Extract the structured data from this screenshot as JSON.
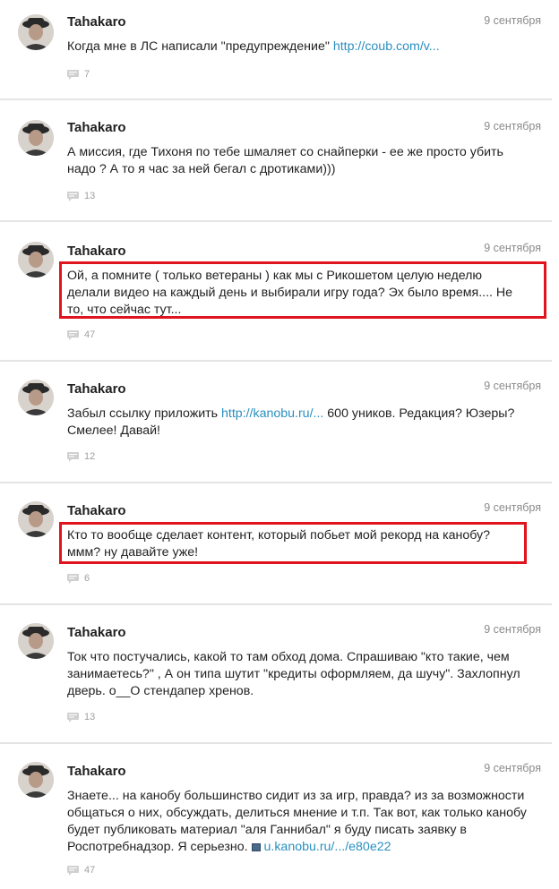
{
  "posts": [
    {
      "author": "Tahakaro",
      "date": "9 сентября",
      "text": "Когда мне в ЛС написали \"предупреждение\" ",
      "link": "http://coub.com/v...",
      "comments": "7"
    },
    {
      "author": "Tahakaro",
      "date": "9 сентября",
      "text": "А миссия, где Тихоня по тебе шмаляет со снайперки - ее же просто убить надо ? А то я час за ней бегал с дротиками)))",
      "comments": "13"
    },
    {
      "author": "Tahakaro",
      "date": "9 сентября",
      "text": "Ой, а помните ( только ветераны ) как мы с Рикошетом целую неделю делали видео на каждый день и выбирали игру года? Эх было время.... Не то, что сейчас тут...",
      "comments": "47"
    },
    {
      "author": "Tahakaro",
      "date": "9 сентября",
      "text_before": "Забыл ссылку приложить ",
      "link": "http://kanobu.ru/...",
      "text_after": " 600 уников. Редакция? Юзеры? Смелее! Давай!",
      "comments": "12"
    },
    {
      "author": "Tahakaro",
      "date": "9 сентября",
      "text": "Кто то вообще сделает контент, который побьет мой рекорд на канобу? ммм? ну давайте уже!",
      "comments": "6"
    },
    {
      "author": "Tahakaro",
      "date": "9 сентября",
      "text": "Ток что постучались, какой то там обход дома. Спрашиваю \"кто такие, чем занимаетесь?\" , А он типа шутит \"кредиты оформляем, да шучу\". Захлопнул дверь. о__О стендапер хренов.",
      "comments": "13"
    },
    {
      "author": "Tahakaro",
      "date": "9 сентября",
      "text": "Знаете... на канобу большинство сидит из за игр, правда? из за возможности общаться о них, обсуждать, делиться мнение и т.п. Так вот, как только канобу будет публиковать материал \"аля Ганнибал\" я буду писать заявку в Роспотребнадзор. Я серьезно. ",
      "link": "u.kanobu.ru/.../e80e22",
      "comments": "47"
    }
  ]
}
